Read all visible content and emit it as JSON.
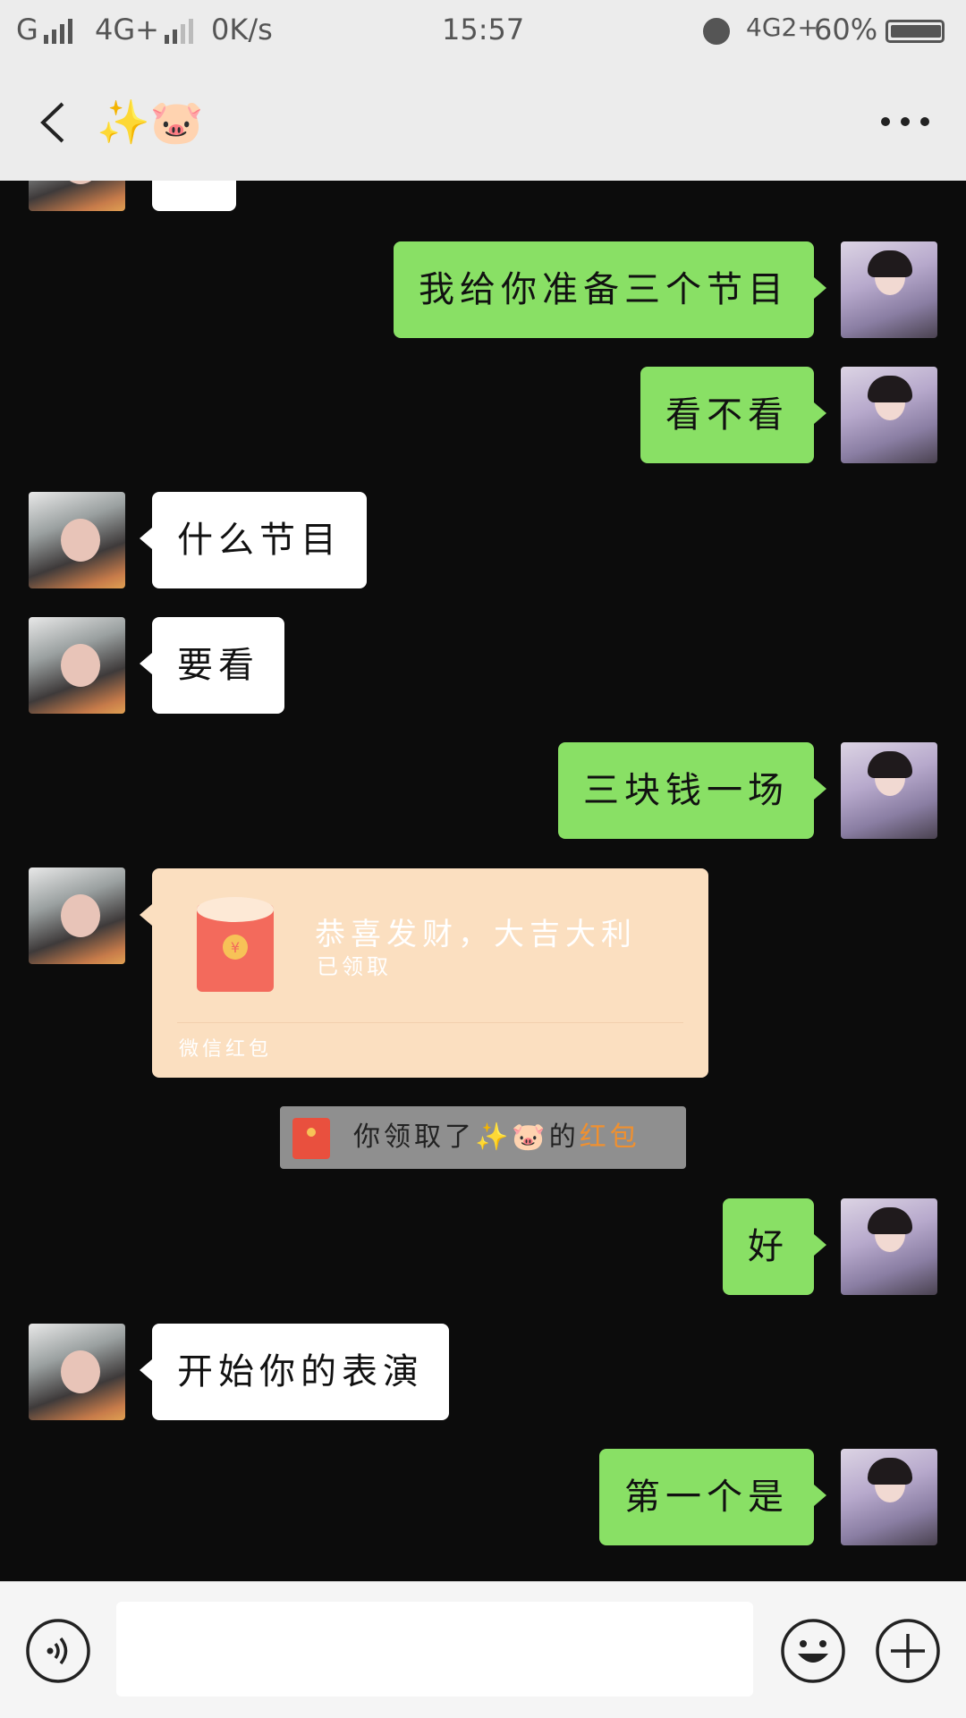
{
  "status_bar": {
    "carrier1": "G",
    "carrier2": "4G+",
    "speed": "0K/s",
    "time": "15:57",
    "network": "4G2+",
    "battery": "60%"
  },
  "header": {
    "title": "✨🐷",
    "icons": {
      "back": "chevron-left-icon",
      "more": "more-dots-icon"
    }
  },
  "messages": [
    {
      "from": "me",
      "text": "我给你准备三个节目"
    },
    {
      "from": "me",
      "text": "看不看"
    },
    {
      "from": "friend",
      "text": "什么节目"
    },
    {
      "from": "friend",
      "text": "要看"
    },
    {
      "from": "me",
      "text": "三块钱一场"
    },
    {
      "from": "friend",
      "type": "red_packet",
      "title": "恭喜发财，大吉大利",
      "status": "已领取",
      "footer": "微信红包"
    },
    {
      "type": "system",
      "prefix": "你领取了✨🐷的",
      "accent": "红包"
    },
    {
      "from": "me",
      "text": "好"
    },
    {
      "from": "friend",
      "text": "开始你的表演"
    },
    {
      "from": "me",
      "text": "第一个是"
    }
  ],
  "input_bar": {
    "value": "",
    "icons": {
      "voice": "voice-icon",
      "emoji": "emoji-icon",
      "plus": "plus-icon"
    }
  },
  "colors": {
    "background": "#0c0c0c",
    "outgoing_bubble": "#89e065",
    "incoming_bubble": "#ffffff",
    "red_packet": "#fbdfc0",
    "accent": "#f0902f"
  }
}
